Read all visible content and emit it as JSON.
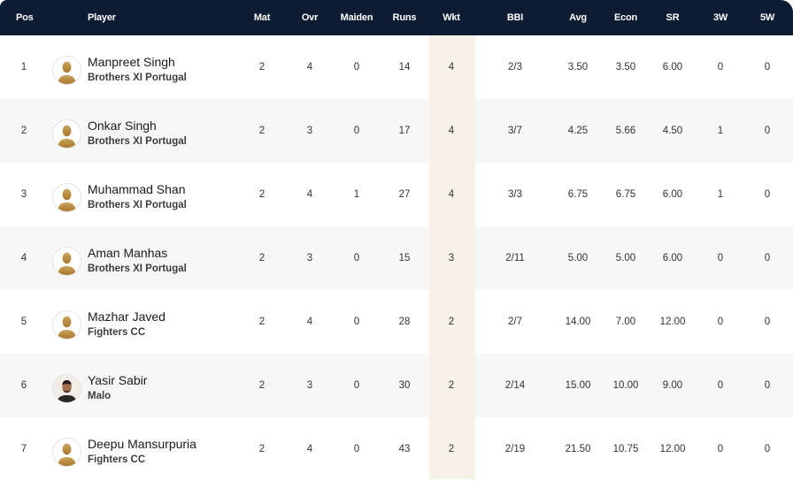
{
  "columns": {
    "pos": "Pos",
    "player": "Player",
    "mat": "Mat",
    "ovr": "Ovr",
    "maiden": "Maiden",
    "runs": "Runs",
    "wkt": "Wkt",
    "bbi": "BBI",
    "avg": "Avg",
    "econ": "Econ",
    "sr": "SR",
    "w3": "3W",
    "w5": "5W"
  },
  "colors": {
    "header_bg": "#0d1b33",
    "highlight_column": "#f7f2e8",
    "alt_row": "#f7f7f7"
  },
  "rows": [
    {
      "pos": "1",
      "name": "Manpreet Singh",
      "team": "Brothers XI Portugal",
      "avatar": "placeholder-silhouette",
      "mat": "2",
      "ovr": "4",
      "maiden": "0",
      "runs": "14",
      "wkt": "4",
      "bbi": "2/3",
      "avg": "3.50",
      "econ": "3.50",
      "sr": "6.00",
      "w3": "0",
      "w5": "0"
    },
    {
      "pos": "2",
      "name": "Onkar Singh",
      "team": "Brothers XI Portugal",
      "avatar": "placeholder-silhouette",
      "mat": "2",
      "ovr": "3",
      "maiden": "0",
      "runs": "17",
      "wkt": "4",
      "bbi": "3/7",
      "avg": "4.25",
      "econ": "5.66",
      "sr": "4.50",
      "w3": "1",
      "w5": "0"
    },
    {
      "pos": "3",
      "name": "Muhammad Shan",
      "team": "Brothers XI Portugal",
      "avatar": "placeholder-silhouette",
      "mat": "2",
      "ovr": "4",
      "maiden": "1",
      "runs": "27",
      "wkt": "4",
      "bbi": "3/3",
      "avg": "6.75",
      "econ": "6.75",
      "sr": "6.00",
      "w3": "1",
      "w5": "0"
    },
    {
      "pos": "4",
      "name": "Aman Manhas",
      "team": "Brothers XI Portugal",
      "avatar": "placeholder-silhouette",
      "mat": "2",
      "ovr": "3",
      "maiden": "0",
      "runs": "15",
      "wkt": "3",
      "bbi": "2/11",
      "avg": "5.00",
      "econ": "5.00",
      "sr": "6.00",
      "w3": "0",
      "w5": "0"
    },
    {
      "pos": "5",
      "name": "Mazhar Javed",
      "team": "Fighters CC",
      "avatar": "placeholder-silhouette",
      "mat": "2",
      "ovr": "4",
      "maiden": "0",
      "runs": "28",
      "wkt": "2",
      "bbi": "2/7",
      "avg": "14.00",
      "econ": "7.00",
      "sr": "12.00",
      "w3": "0",
      "w5": "0"
    },
    {
      "pos": "6",
      "name": "Yasir Sabir",
      "team": "Malo",
      "avatar": "photo",
      "mat": "2",
      "ovr": "3",
      "maiden": "0",
      "runs": "30",
      "wkt": "2",
      "bbi": "2/14",
      "avg": "15.00",
      "econ": "10.00",
      "sr": "9.00",
      "w3": "0",
      "w5": "0"
    },
    {
      "pos": "7",
      "name": "Deepu Mansurpuria",
      "team": "Fighters CC",
      "avatar": "placeholder-silhouette",
      "mat": "2",
      "ovr": "4",
      "maiden": "0",
      "runs": "43",
      "wkt": "2",
      "bbi": "2/19",
      "avg": "21.50",
      "econ": "10.75",
      "sr": "12.00",
      "w3": "0",
      "w5": "0"
    }
  ]
}
